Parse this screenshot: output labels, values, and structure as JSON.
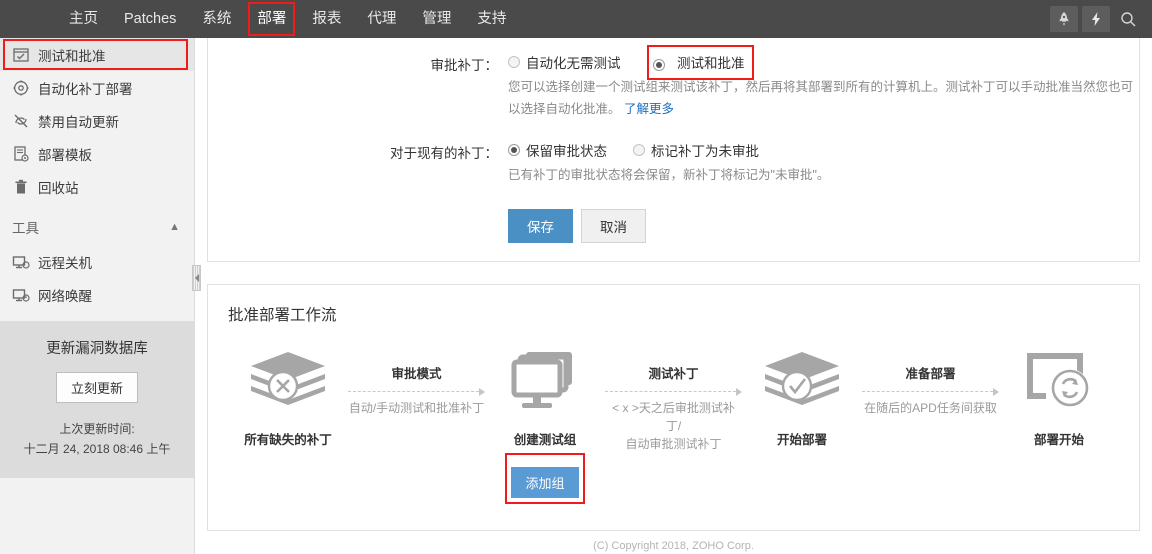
{
  "topnav": {
    "items": [
      {
        "label": "主页",
        "active": false
      },
      {
        "label": "Patches",
        "active": false
      },
      {
        "label": "系统",
        "active": false
      },
      {
        "label": "部署",
        "active": true
      },
      {
        "label": "报表",
        "active": false
      },
      {
        "label": "代理",
        "active": false
      },
      {
        "label": "管理",
        "active": false
      },
      {
        "label": "支持",
        "active": false
      }
    ],
    "icons": [
      {
        "name": "rocket-icon",
        "boxed": true
      },
      {
        "name": "lightning-icon",
        "boxed": true
      },
      {
        "name": "search-icon",
        "boxed": false
      }
    ],
    "accent_color": "#f01c1c",
    "bar_color": "#4a4a4a"
  },
  "sidebar": {
    "items": [
      {
        "label": "测试和批准",
        "icon": "checkbox-window-icon",
        "selected": true
      },
      {
        "label": "自动化补丁部署",
        "icon": "gear-clock-icon",
        "selected": false
      },
      {
        "label": "禁用自动更新",
        "icon": "no-refresh-icon",
        "selected": false
      },
      {
        "label": "部署模板",
        "icon": "document-gear-icon",
        "selected": false
      },
      {
        "label": "回收站",
        "icon": "trash-icon",
        "selected": false
      }
    ],
    "group": {
      "label": "工具",
      "expanded": true
    },
    "tools": [
      {
        "label": "远程关机",
        "icon": "monitor-power-icon"
      },
      {
        "label": "网络唤醒",
        "icon": "monitor-wake-icon"
      }
    ],
    "vuln_panel": {
      "title": "更新漏洞数据库",
      "button": "立刻更新",
      "last_update_label": "上次更新时间:",
      "last_update_value": "十二月 24, 2018 08:46 上午"
    }
  },
  "form": {
    "row1": {
      "label": "审批补丁：",
      "options": [
        {
          "label": "自动化无需测试",
          "selected": false,
          "highlighted": false
        },
        {
          "label": "测试和批准",
          "selected": true,
          "highlighted": true
        }
      ],
      "help": "您可以选择创建一个测试组来测试该补丁，然后再将其部署到所有的计算机上。测试补丁可以手动批准当然您也可以选择自动化批准。",
      "help_link": "了解更多"
    },
    "row2": {
      "label": "对于现有的补丁：",
      "options": [
        {
          "label": "保留审批状态",
          "selected": true,
          "highlighted": false
        },
        {
          "label": "标记补丁为未审批",
          "selected": false,
          "highlighted": false
        }
      ],
      "help": "已有补丁的审批状态将会保留，新补丁将标记为\"未审批\"。"
    },
    "buttons": {
      "save": "保存",
      "cancel": "取消"
    }
  },
  "workflow": {
    "title": "批准部署工作流",
    "nodes": [
      {
        "icon": "layers-x-icon",
        "label": "所有缺失的补丁",
        "button": null,
        "highlighted": false
      },
      {
        "icon": "monitor-stack-icon",
        "label": "创建测试组",
        "button": "添加组",
        "highlighted": true
      },
      {
        "icon": "layers-check-icon",
        "label": "开始部署",
        "button": null,
        "highlighted": false
      },
      {
        "icon": "monitor-sync-icon",
        "label": "部署开始",
        "button": null,
        "highlighted": false
      }
    ],
    "connectors": [
      {
        "title": "审批模式",
        "sub": "自动/手动测试和批准补丁"
      },
      {
        "title": "测试补丁",
        "sub": "< x >天之后审批测试补丁/\n自动审批测试补丁"
      },
      {
        "title": "准备部署",
        "sub": "在随后的APD任务间获取"
      }
    ]
  },
  "footer": {
    "text": "(C) Copyright 2018, ZOHO Corp."
  }
}
